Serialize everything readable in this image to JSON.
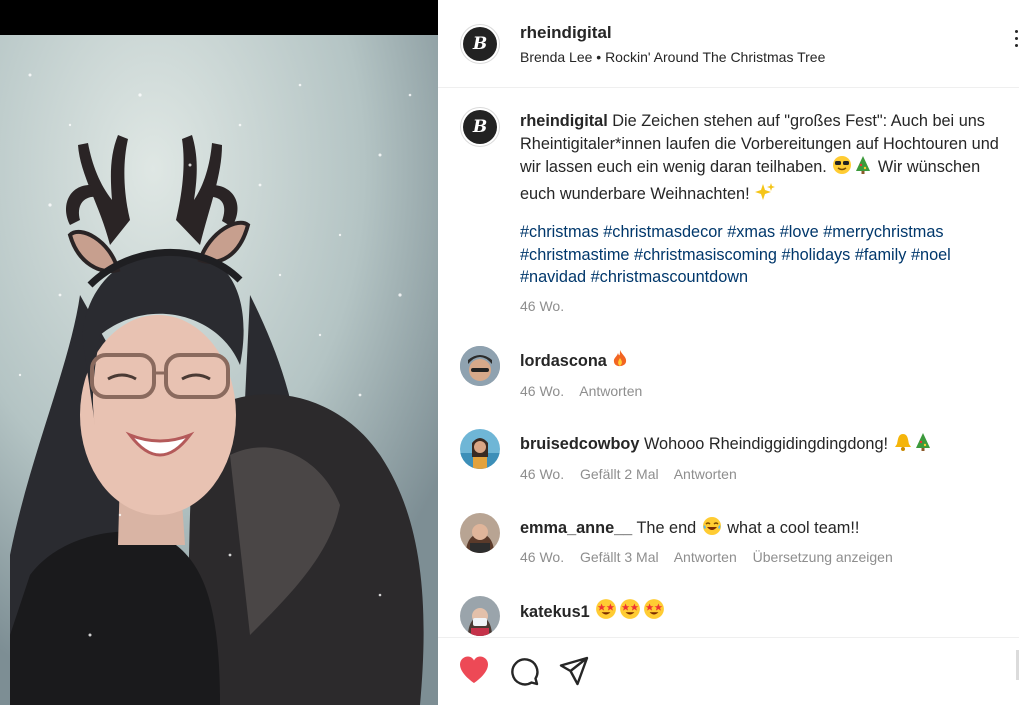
{
  "post": {
    "username": "rheindigital",
    "music": "Brenda Lee • Rockin' Around The Christmas Tree",
    "caption_user": "rheindigital",
    "caption_text": "Die Zeichen stehen auf \"großes Fest\": Auch bei uns Rheintigitaler*innen laufen die Vorbereitungen auf Hochtouren und wir lassen euch ein wenig daran teilhaben.",
    "caption_text2": "Wir wünschen euch wunderbare Weihnachten!",
    "hashtags": [
      "#christmas",
      "#christmasdecor",
      "#xmas",
      "#love",
      "#merrychristmas",
      "#christmastime",
      "#christmasiscoming",
      "#holidays",
      "#family",
      "#noel",
      "#navidad",
      "#christmascountdown"
    ],
    "caption_time": "46 Wo."
  },
  "comments": [
    {
      "user": "lordascona",
      "text": "",
      "time": "46 Wo.",
      "likes": "",
      "reply": "Antworten",
      "translate": ""
    },
    {
      "user": "bruisedcowboy",
      "text": "Wohooo Rheindiggidingdingdong!",
      "time": "46 Wo.",
      "likes": "Gefällt 2 Mal",
      "reply": "Antworten",
      "translate": ""
    },
    {
      "user": "emma_anne__",
      "text": "The end",
      "text2": "what a cool team!!",
      "time": "46 Wo.",
      "likes": "Gefällt 3 Mal",
      "reply": "Antworten",
      "translate": "Übersetzung anzeigen"
    },
    {
      "user": "katekus1",
      "text": "",
      "time": "",
      "likes": "",
      "reply": "",
      "translate": ""
    }
  ],
  "icons": {
    "like": "heart-icon",
    "comment": "comment-icon",
    "share": "paper-plane-icon",
    "more": "more-dots-icon",
    "logo": "rheindigital-logo"
  },
  "colors": {
    "like_red": "#ed4956",
    "hashtag": "#00376b",
    "meta_gray": "#8e8e8e"
  }
}
